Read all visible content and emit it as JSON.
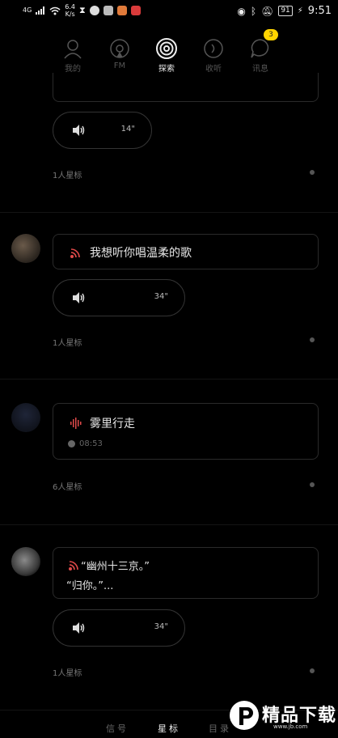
{
  "status_bar": {
    "signal": "4G",
    "speed_value": "6.4",
    "speed_unit": "K/s",
    "battery": "91",
    "time": "9:51"
  },
  "nav": {
    "items": [
      {
        "label": "我的"
      },
      {
        "label": "FM"
      },
      {
        "label": "探索"
      },
      {
        "label": "收听"
      },
      {
        "label": "讯息"
      }
    ],
    "badge_count": "3"
  },
  "feed": [
    {
      "voice_duration": "14\"",
      "stars": "1人星标"
    },
    {
      "text": "我想听你唱温柔的歌",
      "voice_duration": "34\"",
      "stars": "1人星标"
    },
    {
      "title": "雾里行走",
      "time": "08:53",
      "stars": "6人星标"
    },
    {
      "text_line1": "“幽州十三京。”",
      "text_line2": "“归你。”...",
      "voice_duration": "34\"",
      "stars": "1人星标"
    }
  ],
  "bottom_tabs": [
    {
      "label": "信号"
    },
    {
      "label": "星标"
    },
    {
      "label": "目录"
    }
  ],
  "watermark": {
    "text": "精品下载",
    "url": "www.jb.com"
  },
  "colors": {
    "accent_red": "#e04a4a",
    "badge": "#ffd400",
    "background": "#000000"
  }
}
